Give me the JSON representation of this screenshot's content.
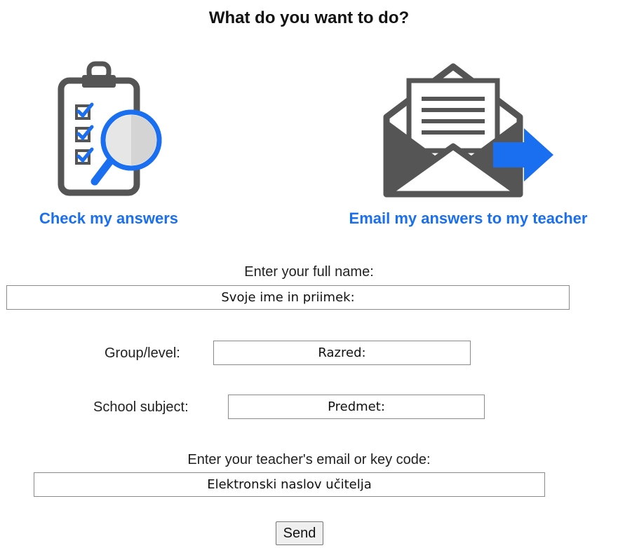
{
  "heading": "What do you want to do?",
  "options": {
    "check": {
      "label": "Check my answers",
      "icon": "clipboard-checklist-magnifier-icon"
    },
    "email": {
      "label": "Email my answers to my teacher",
      "icon": "envelope-arrow-icon"
    }
  },
  "form": {
    "full_name": {
      "label": "Enter your full name:",
      "placeholder": "Svoje ime in priimek:"
    },
    "group": {
      "label": "Group/level:",
      "placeholder": "Razred:"
    },
    "subject": {
      "label": "School subject:",
      "placeholder": "Predmet:"
    },
    "teacher": {
      "label": "Enter your teacher's email or key code:",
      "placeholder": "Elektronski naslov učitelja"
    },
    "send_label": "Send"
  },
  "colors": {
    "accent": "#1a6ff0",
    "icon_gray": "#555555"
  }
}
